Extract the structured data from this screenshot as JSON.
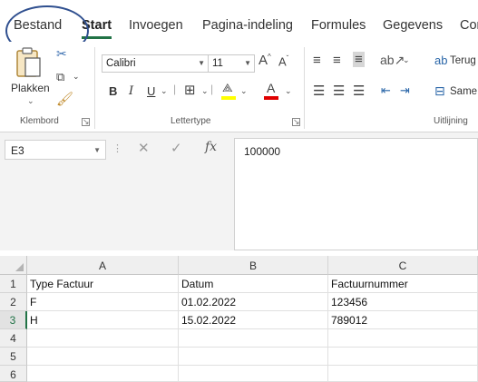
{
  "tabs": [
    {
      "label": "Bestand"
    },
    {
      "label": "Start"
    },
    {
      "label": "Invoegen"
    },
    {
      "label": "Pagina-indeling"
    },
    {
      "label": "Formules"
    },
    {
      "label": "Gegevens"
    },
    {
      "label": "Cor"
    }
  ],
  "ribbon": {
    "clipboard": {
      "paste_label": "Plakken",
      "group_label": "Klembord"
    },
    "font": {
      "font_name": "Calibri",
      "font_size": "11",
      "group_label": "Lettertype",
      "bold": "B",
      "italic": "I",
      "underline": "U"
    },
    "alignment": {
      "wrap_label": "Terug",
      "merge_label": "Same",
      "group_label": "Uitlijning"
    }
  },
  "formula_bar": {
    "cell_ref": "E3",
    "value": "100000",
    "fx": "fx"
  },
  "grid": {
    "columns": [
      "A",
      "B",
      "C"
    ],
    "rows": [
      {
        "num": "1",
        "cells": [
          "Type Factuur",
          "Datum",
          "Factuurnummer"
        ]
      },
      {
        "num": "2",
        "cells": [
          "F",
          "01.02.2022",
          "123456"
        ]
      },
      {
        "num": "3",
        "cells": [
          "H",
          "15.02.2022",
          "789012"
        ]
      },
      {
        "num": "4",
        "cells": [
          "",
          "",
          ""
        ]
      },
      {
        "num": "5",
        "cells": [
          "",
          "",
          ""
        ]
      },
      {
        "num": "6",
        "cells": [
          "",
          "",
          ""
        ]
      }
    ]
  },
  "colors": {
    "accent": "#217346",
    "annotation_circle": "#2f4f8f",
    "font_color_bar": "#e00000",
    "highlight_bar": "#ffff00"
  }
}
